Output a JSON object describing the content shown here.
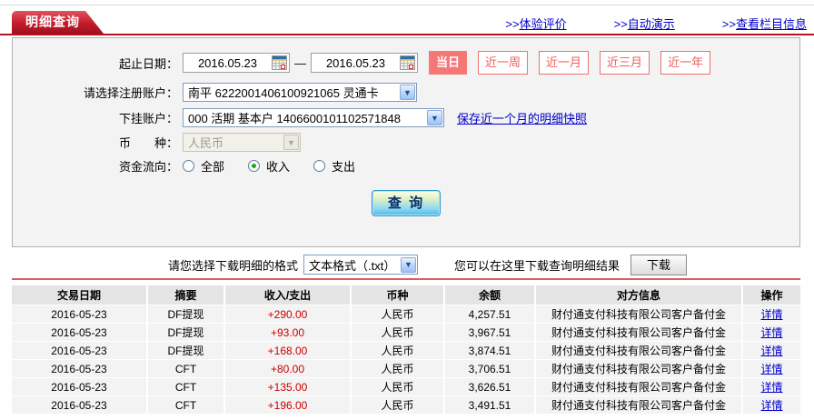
{
  "header": {
    "tab_title": "明细查询",
    "links": [
      {
        "prefix": ">>",
        "label": "体验评价"
      },
      {
        "prefix": ">>",
        "label": "自动演示"
      },
      {
        "prefix": ">>",
        "label": "查看栏目信息"
      }
    ]
  },
  "form": {
    "date_label": "起止日期：",
    "date_from": "2016.05.23",
    "date_separator": "—",
    "date_to": "2016.05.23",
    "quick_buttons": [
      {
        "label": "当日",
        "active": true
      },
      {
        "label": "近一周",
        "active": false
      },
      {
        "label": "近一月",
        "active": false
      },
      {
        "label": "近三月",
        "active": false
      },
      {
        "label": "近一年",
        "active": false
      }
    ],
    "account_label": "请选择注册账户：",
    "account_value": "南平 6222001406100921065 灵通卡",
    "sub_account_label": "下挂账户：",
    "sub_account_value": "000 活期 基本户 1406600101102571848",
    "snapshot_link": "保存近一个月的明细快照",
    "currency_label": "币　　种：",
    "currency_value": "人民币",
    "flow_label": "资金流向：",
    "flow_options": [
      {
        "label": "全部",
        "checked": false
      },
      {
        "label": "收入",
        "checked": true
      },
      {
        "label": "支出",
        "checked": false
      }
    ],
    "query_button": "查 询"
  },
  "download": {
    "format_label": "请您选择下载明细的格式",
    "format_value": "文本格式（.txt）",
    "hint": "您可以在这里下载查询明细结果",
    "button": "下载"
  },
  "table": {
    "headers": [
      "交易日期",
      "摘要",
      "收入/支出",
      "币种",
      "余额",
      "对方信息",
      "操作"
    ],
    "rows": [
      [
        "2016-05-23",
        "DF提现",
        "+290.00",
        "人民币",
        "4,257.51",
        "财付通支付科技有限公司客户备付金",
        "详情"
      ],
      [
        "2016-05-23",
        "DF提现",
        "+93.00",
        "人民币",
        "3,967.51",
        "财付通支付科技有限公司客户备付金",
        "详情"
      ],
      [
        "2016-05-23",
        "DF提现",
        "+168.00",
        "人民币",
        "3,874.51",
        "财付通支付科技有限公司客户备付金",
        "详情"
      ],
      [
        "2016-05-23",
        "CFT",
        "+80.00",
        "人民币",
        "3,706.51",
        "财付通支付科技有限公司客户备付金",
        "详情"
      ],
      [
        "2016-05-23",
        "CFT",
        "+135.00",
        "人民币",
        "3,626.51",
        "财付通支付科技有限公司客户备付金",
        "详情"
      ],
      [
        "2016-05-23",
        "CFT",
        "+196.00",
        "人民币",
        "3,491.51",
        "财付通支付科技有限公司客户备付金",
        "详情"
      ]
    ]
  },
  "colors": {
    "tab_red": "#c41b2a",
    "underline_red": "#b5121f",
    "quick_button_salmon": "#f57878",
    "link_blue": "#0000cc",
    "amount_red": "#cc0000",
    "table_line_red": "#e05c5c"
  }
}
